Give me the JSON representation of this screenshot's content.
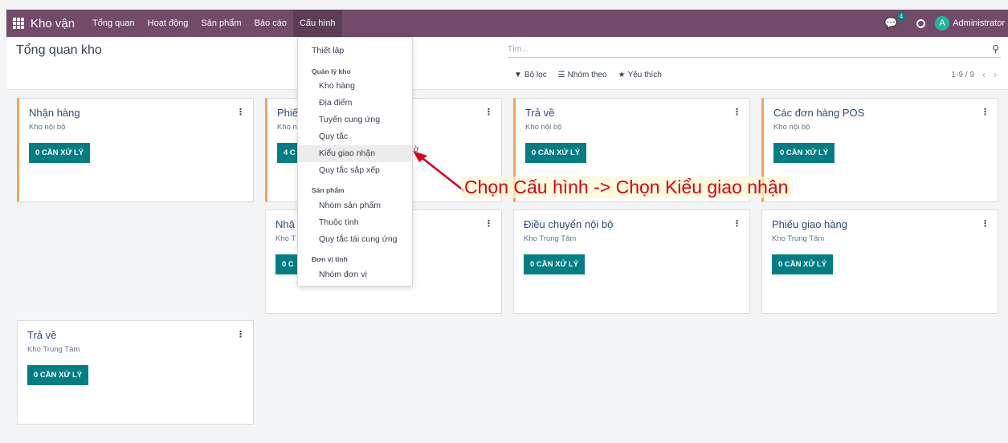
{
  "navbar": {
    "brand": "Kho vận",
    "menu": [
      "Tổng quan",
      "Hoạt động",
      "Sản phẩm",
      "Báo cáo",
      "Cấu hình"
    ],
    "chat_count": "4",
    "avatar_letter": "A",
    "user": "Administrator"
  },
  "control": {
    "title": "Tổng quan kho",
    "search_placeholder": "Tìm...",
    "filter": "Bộ lọc",
    "group_by": "Nhóm theo",
    "favorites": "Yêu thích",
    "pager": "1-9 / 9"
  },
  "cards": [
    {
      "title": "Nhận hàng",
      "sub": "Kho nội bộ",
      "btn": "0 CẦN XỬ LÝ"
    },
    {
      "title": "Phiế",
      "sub": "Kho n",
      "btn": "4 C"
    },
    {
      "title": "Trả về",
      "sub": "Kho nội bộ",
      "btn": "0 CẦN XỬ LÝ"
    },
    {
      "title": "Các đơn hàng POS",
      "sub": "Kho nội bộ",
      "btn": "0 CẦN XỬ LÝ"
    },
    {
      "title": "Nhậ",
      "sub": "Kho T",
      "btn": "0 C"
    },
    {
      "title": "Điều chuyển nội bộ",
      "sub": "Kho Trung Tâm",
      "btn": "0 CẦN XỬ LÝ"
    },
    {
      "title": "Phiếu giao hàng",
      "sub": "Kho Trung Tâm",
      "btn": "0 CẦN XỬ LÝ"
    },
    {
      "title": "Trả về",
      "sub": "Kho Trung Tâm",
      "btn": "0 CẦN XỬ LÝ"
    }
  ],
  "card_fragment": "ờ",
  "dropdown": {
    "setup": "Thiết lập",
    "section_warehouse": "Quản lý kho",
    "warehouses": "Kho hàng",
    "locations": "Địa điểm",
    "routes": "Tuyến cung ứng",
    "rules": "Quy tắc",
    "operation_types": "Kiểu giao nhận",
    "putaway_rules": "Quy tắc sắp xếp",
    "section_products": "Sản phẩm",
    "product_categories": "Nhóm sản phẩm",
    "attributes": "Thuộc tính",
    "reorder_rules": "Quy tắc tái cung ứng",
    "section_uom": "Đơn vị tính",
    "uom_categories": "Nhóm đơn vị"
  },
  "annotation": "Chọn Cấu hình -> Chọn Kiểu giao nhận",
  "colors": {
    "navbar": "#714b67",
    "button": "#017e84",
    "accent": "#f0a45d",
    "annotation": "#d6001c"
  }
}
